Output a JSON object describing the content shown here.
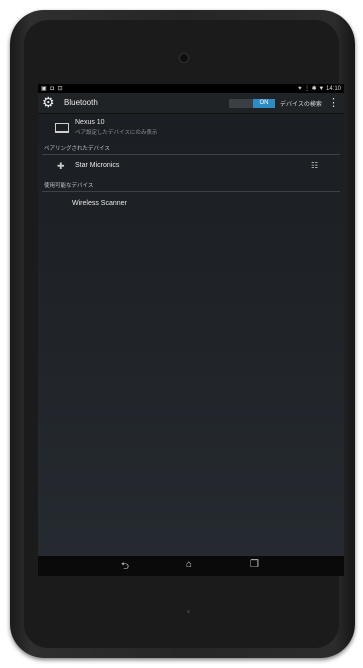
{
  "statusbar": {
    "left_icons": "▣ ◘ ⊡",
    "right_icons": "✦ ⋮ ✱ ▼",
    "time": "14:10"
  },
  "actionbar": {
    "title": "Bluetooth",
    "toggle_label": "ON",
    "search_label": "デバイスの検索"
  },
  "this_device": {
    "name": "Nexus 10",
    "subtitle": "ペア設定したデバイスにのみ表示"
  },
  "paired": {
    "header": "ペアリングされたデバイス",
    "items": [
      {
        "name": "Star Micronics"
      }
    ]
  },
  "available": {
    "header": "使用可能なデバイス",
    "items": [
      {
        "name": "Wireless Scanner"
      }
    ]
  },
  "icons": {
    "settings": "settings-icon",
    "laptop": "laptop-icon",
    "printer": "printer-icon",
    "back": "back-icon",
    "home": "home-icon",
    "recents": "recents-icon",
    "overflow": "overflow-menu-icon",
    "device_settings": "tune-icon"
  },
  "colors": {
    "accent": "#2e8cc4",
    "screen_bg": "#1f2328"
  }
}
